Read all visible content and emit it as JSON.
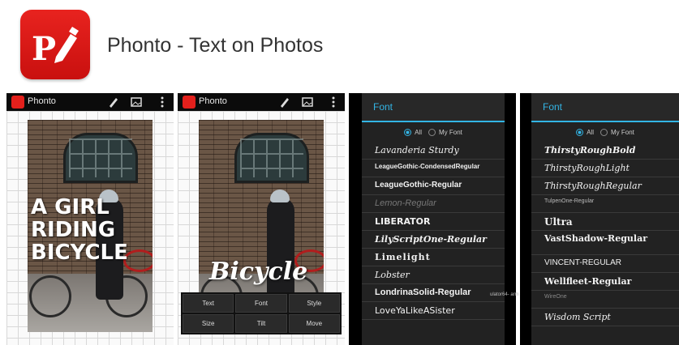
{
  "app": {
    "title": "Phonto - Text on Photos",
    "icon_color": "#d91a17"
  },
  "screen1": {
    "actionbar_title": "Phonto",
    "overlay_lines": [
      "A GIRL",
      "RIDING",
      "BICYCLE"
    ]
  },
  "screen2": {
    "actionbar_title": "Phonto",
    "overlay_text": "Bicycle",
    "tools": [
      "Text",
      "Font",
      "Style",
      "Size",
      "Tilt",
      "Move"
    ]
  },
  "screen3": {
    "dialog_title": "Font",
    "filter_all": "All",
    "filter_my": "My Font",
    "fonts": [
      "Lavanderia Sturdy",
      "LeagueGothic-CondensedRegular",
      "LeagueGothic-Regular",
      "Lemon-Regular",
      "LIBERATOR",
      "LilyScriptOne-Regular",
      "Limelight",
      "Lobster",
      "LondrinaSolid-Regular",
      "LoveYaLikeASister"
    ]
  },
  "screen4": {
    "dialog_title": "Font",
    "filter_all": "All",
    "filter_my": "My Font",
    "fonts": [
      "ThirstyRoughBold",
      "ThirstyRoughLight",
      "ThirstyRoughRegular",
      "TulpenOne-Regular",
      "Ultra",
      "VastShadow-Regular",
      "VINCENT-REGULAR",
      "Wellfleet-Regular",
      "WireOne",
      "Wisdom Script"
    ]
  },
  "watermark": "ulator64- arm",
  "accent_color": "#33b5e5"
}
